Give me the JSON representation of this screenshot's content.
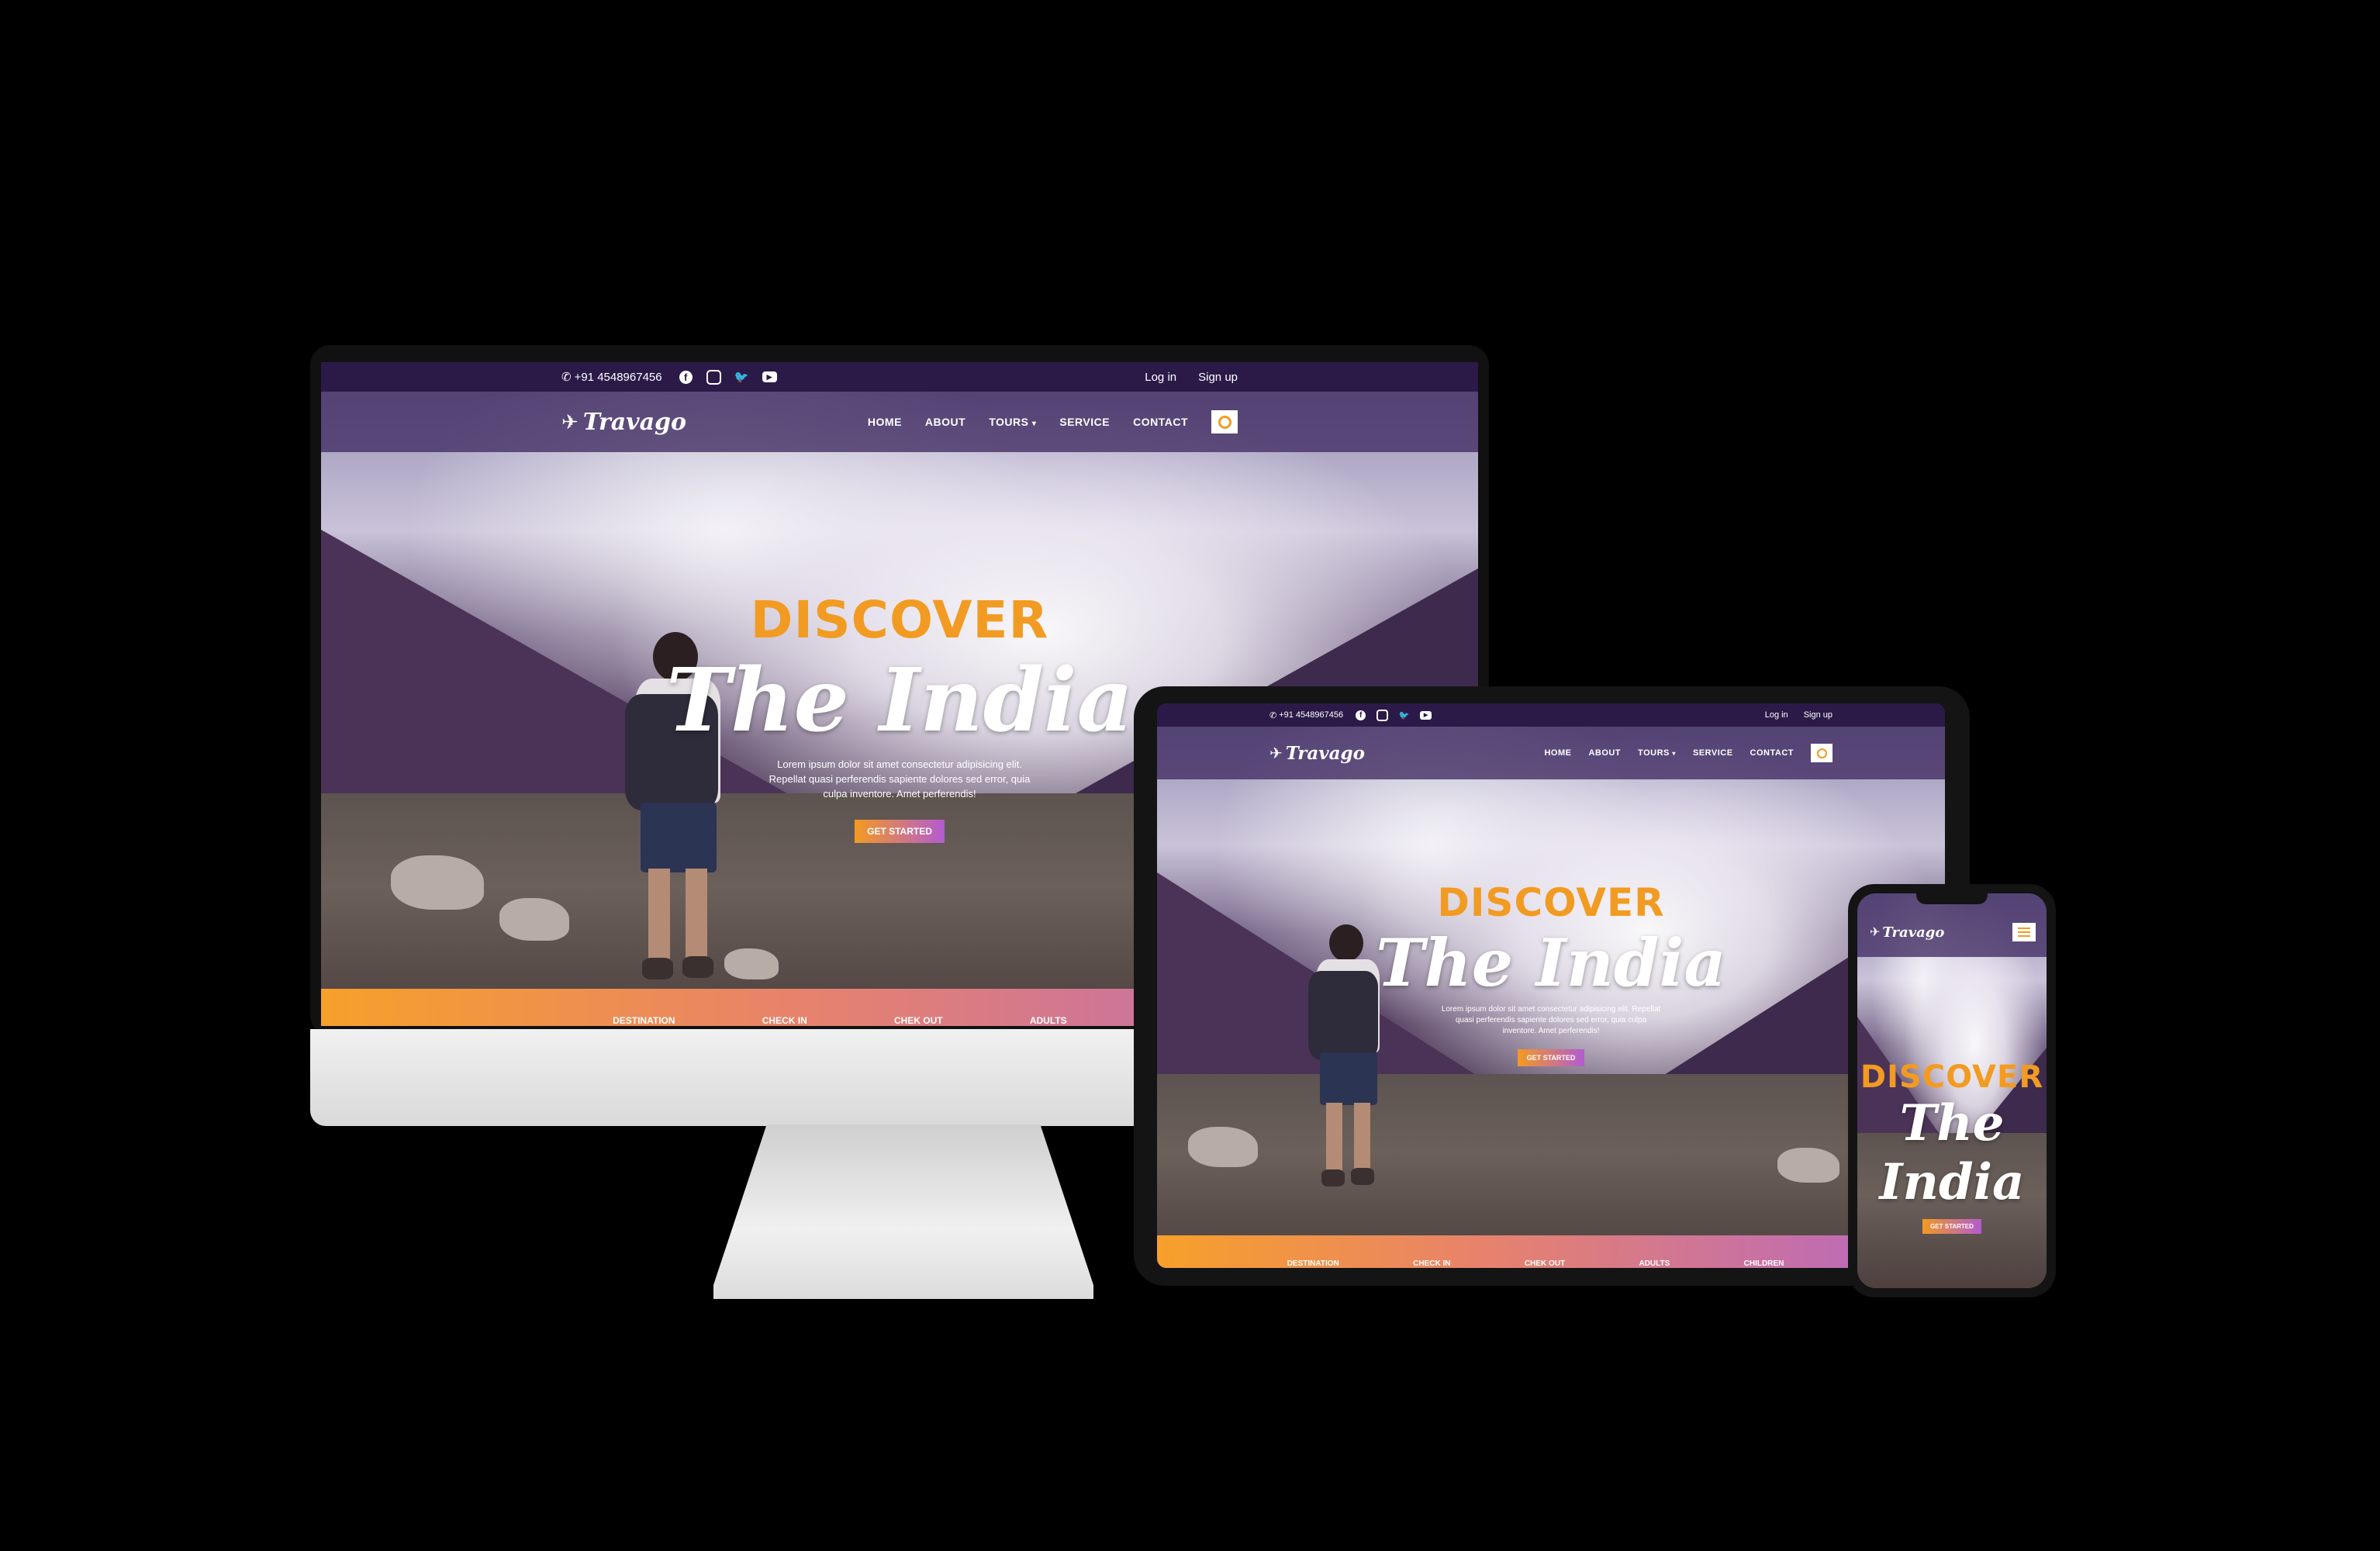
{
  "site": {
    "phone": "+91 4548967456",
    "social_icons": [
      "facebook-icon",
      "instagram-icon",
      "twitter-icon",
      "youtube-icon"
    ],
    "login": "Log in",
    "signup": "Sign up",
    "logo": "Travago",
    "nav": [
      "HOME",
      "ABOUT",
      "TOURS",
      "SERVICE",
      "CONTACT"
    ],
    "tours_caret": "▾",
    "hero": {
      "kicker": "DISCOVER",
      "title": "The India",
      "title_line1": "The",
      "title_line2": "India",
      "lorem": "Lorem ipsum dolor sit amet consectetur adipisicing elit. Repellat quasi perferendis sapiente dolores sed error, quia culpa inventore. Amet perferendis!",
      "cta": "GET STARTED"
    },
    "booking": [
      "DESTINATION",
      "CHECK IN",
      "CHEK OUT",
      "ADULTS",
      "CHILDREN"
    ],
    "colors": {
      "accent_orange": "#f29b22",
      "purple_dark": "#2b1a48",
      "gradient_end": "#b466c6"
    }
  }
}
